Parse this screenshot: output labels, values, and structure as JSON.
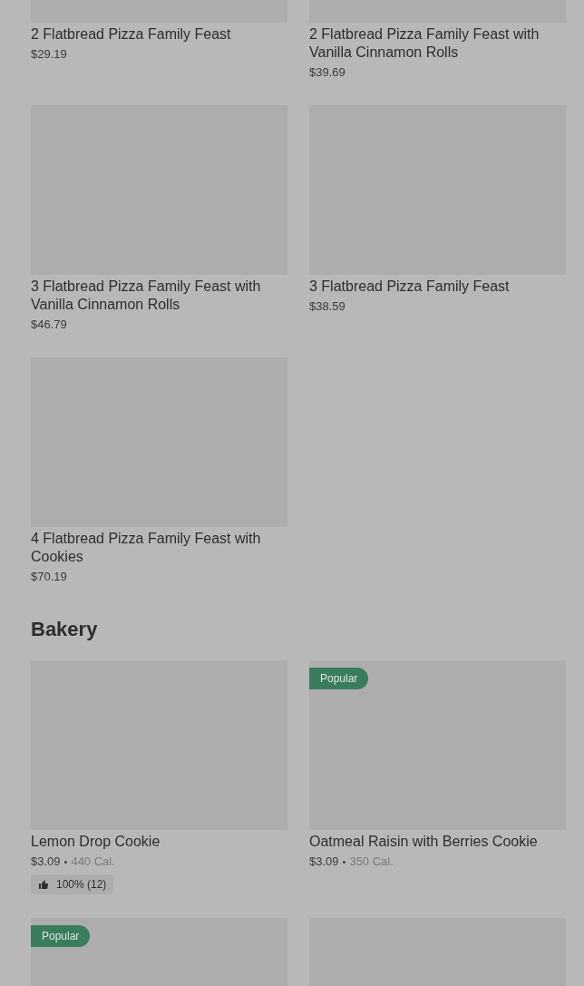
{
  "sections": [
    {
      "items": [
        {
          "kind": "picture",
          "name": "2 Flatbread Pizza Family Feast",
          "price": "$29.19"
        },
        {
          "kind": "picture",
          "name": "2 Flatbread Pizza Family Feast with Vanilla Cinnamon Rolls",
          "price": "$39.69"
        },
        {
          "kind": "picture",
          "name": "3 Flatbread Pizza Family Feast with Vanilla Cinnamon Rolls",
          "price": "$46.79"
        },
        {
          "kind": "picture",
          "name": "3 Flatbread Pizza Family Feast",
          "price": "$38.59"
        },
        {
          "kind": "picture",
          "name": "4 Flatbread Pizza Family Feast with Cookies",
          "price": "$70.19"
        }
      ]
    },
    {
      "title": "Bakery",
      "items": [
        {
          "kind": "picture",
          "name": "Lemon Drop Cookie",
          "price": "$3.09",
          "separator": "•",
          "calories": "440 Cal.",
          "rating": "100% (12)"
        },
        {
          "kind": "picture",
          "name": "Oatmeal Raisin with Berries Cookie",
          "price": "$3.09",
          "separator": "•",
          "calories": "350 Cal.",
          "badge": "Popular"
        },
        {
          "kind": "picture",
          "badge": "Popular"
        },
        {
          "kind": "picture"
        }
      ]
    }
  ]
}
